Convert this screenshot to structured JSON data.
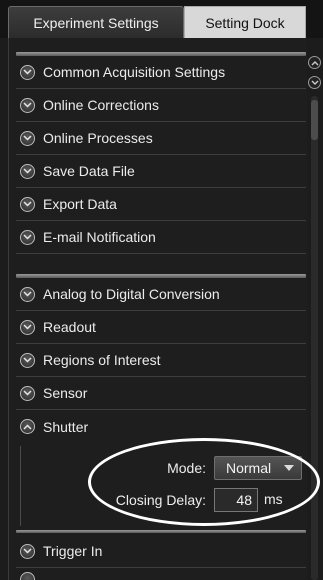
{
  "tabs": {
    "experiment_settings": "Experiment Settings",
    "setting_dock": "Setting Dock"
  },
  "group1": [
    {
      "label": "Common Acquisition Settings",
      "expanded": false
    },
    {
      "label": "Online Corrections",
      "expanded": false
    },
    {
      "label": "Online Processes",
      "expanded": false
    },
    {
      "label": "Save Data File",
      "expanded": false
    },
    {
      "label": "Export Data",
      "expanded": false
    },
    {
      "label": "E-mail Notification",
      "expanded": false
    }
  ],
  "group2": [
    {
      "label": "Analog to Digital Conversion",
      "expanded": false
    },
    {
      "label": "Readout",
      "expanded": false
    },
    {
      "label": "Regions of Interest",
      "expanded": false
    },
    {
      "label": "Sensor",
      "expanded": false
    },
    {
      "label": "Shutter",
      "expanded": true
    }
  ],
  "shutter": {
    "mode_label": "Mode:",
    "mode_value": "Normal",
    "closing_delay_label": "Closing Delay:",
    "closing_delay_value": "48",
    "closing_delay_unit": "ms"
  },
  "after_shutter": [
    {
      "label": "Trigger In",
      "expanded": false
    }
  ],
  "colors": {
    "background": "#1c1c1c",
    "highlight_oval": "#ffffff"
  },
  "icons": {
    "collapsed": "chevron-down-circle-icon",
    "expanded": "chevron-up-circle-icon"
  }
}
